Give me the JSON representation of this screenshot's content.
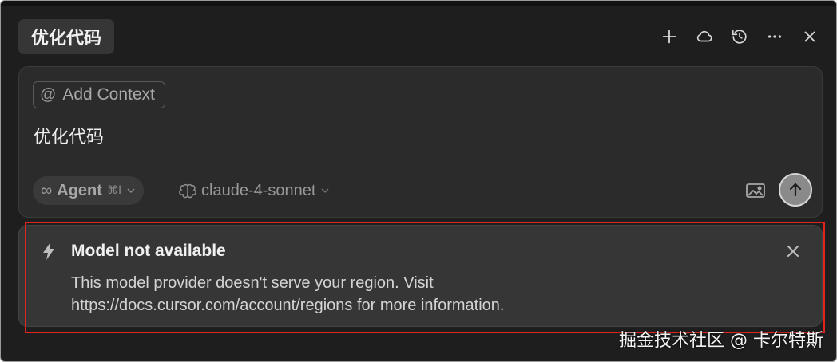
{
  "header": {
    "title": "优化代码",
    "actions": [
      {
        "icon": "plus-icon"
      },
      {
        "icon": "cloud-icon"
      },
      {
        "icon": "history-icon"
      },
      {
        "icon": "more-icon"
      },
      {
        "icon": "close-icon"
      }
    ]
  },
  "composer": {
    "add_context_icon": "@",
    "add_context_label": "Add Context",
    "prompt": "优化代码",
    "mode": {
      "icon": "∞",
      "label": "Agent",
      "shortcut": "⌘I"
    },
    "model": {
      "name": "claude-4-sonnet"
    }
  },
  "notice": {
    "title": "Model not available",
    "body": "This model provider doesn't serve your region. Visit https://docs.cursor.com/account/regions for more information.",
    "highlight_color": "#e0241f"
  },
  "watermark": "掘金技术社区 @ 卡尔特斯"
}
